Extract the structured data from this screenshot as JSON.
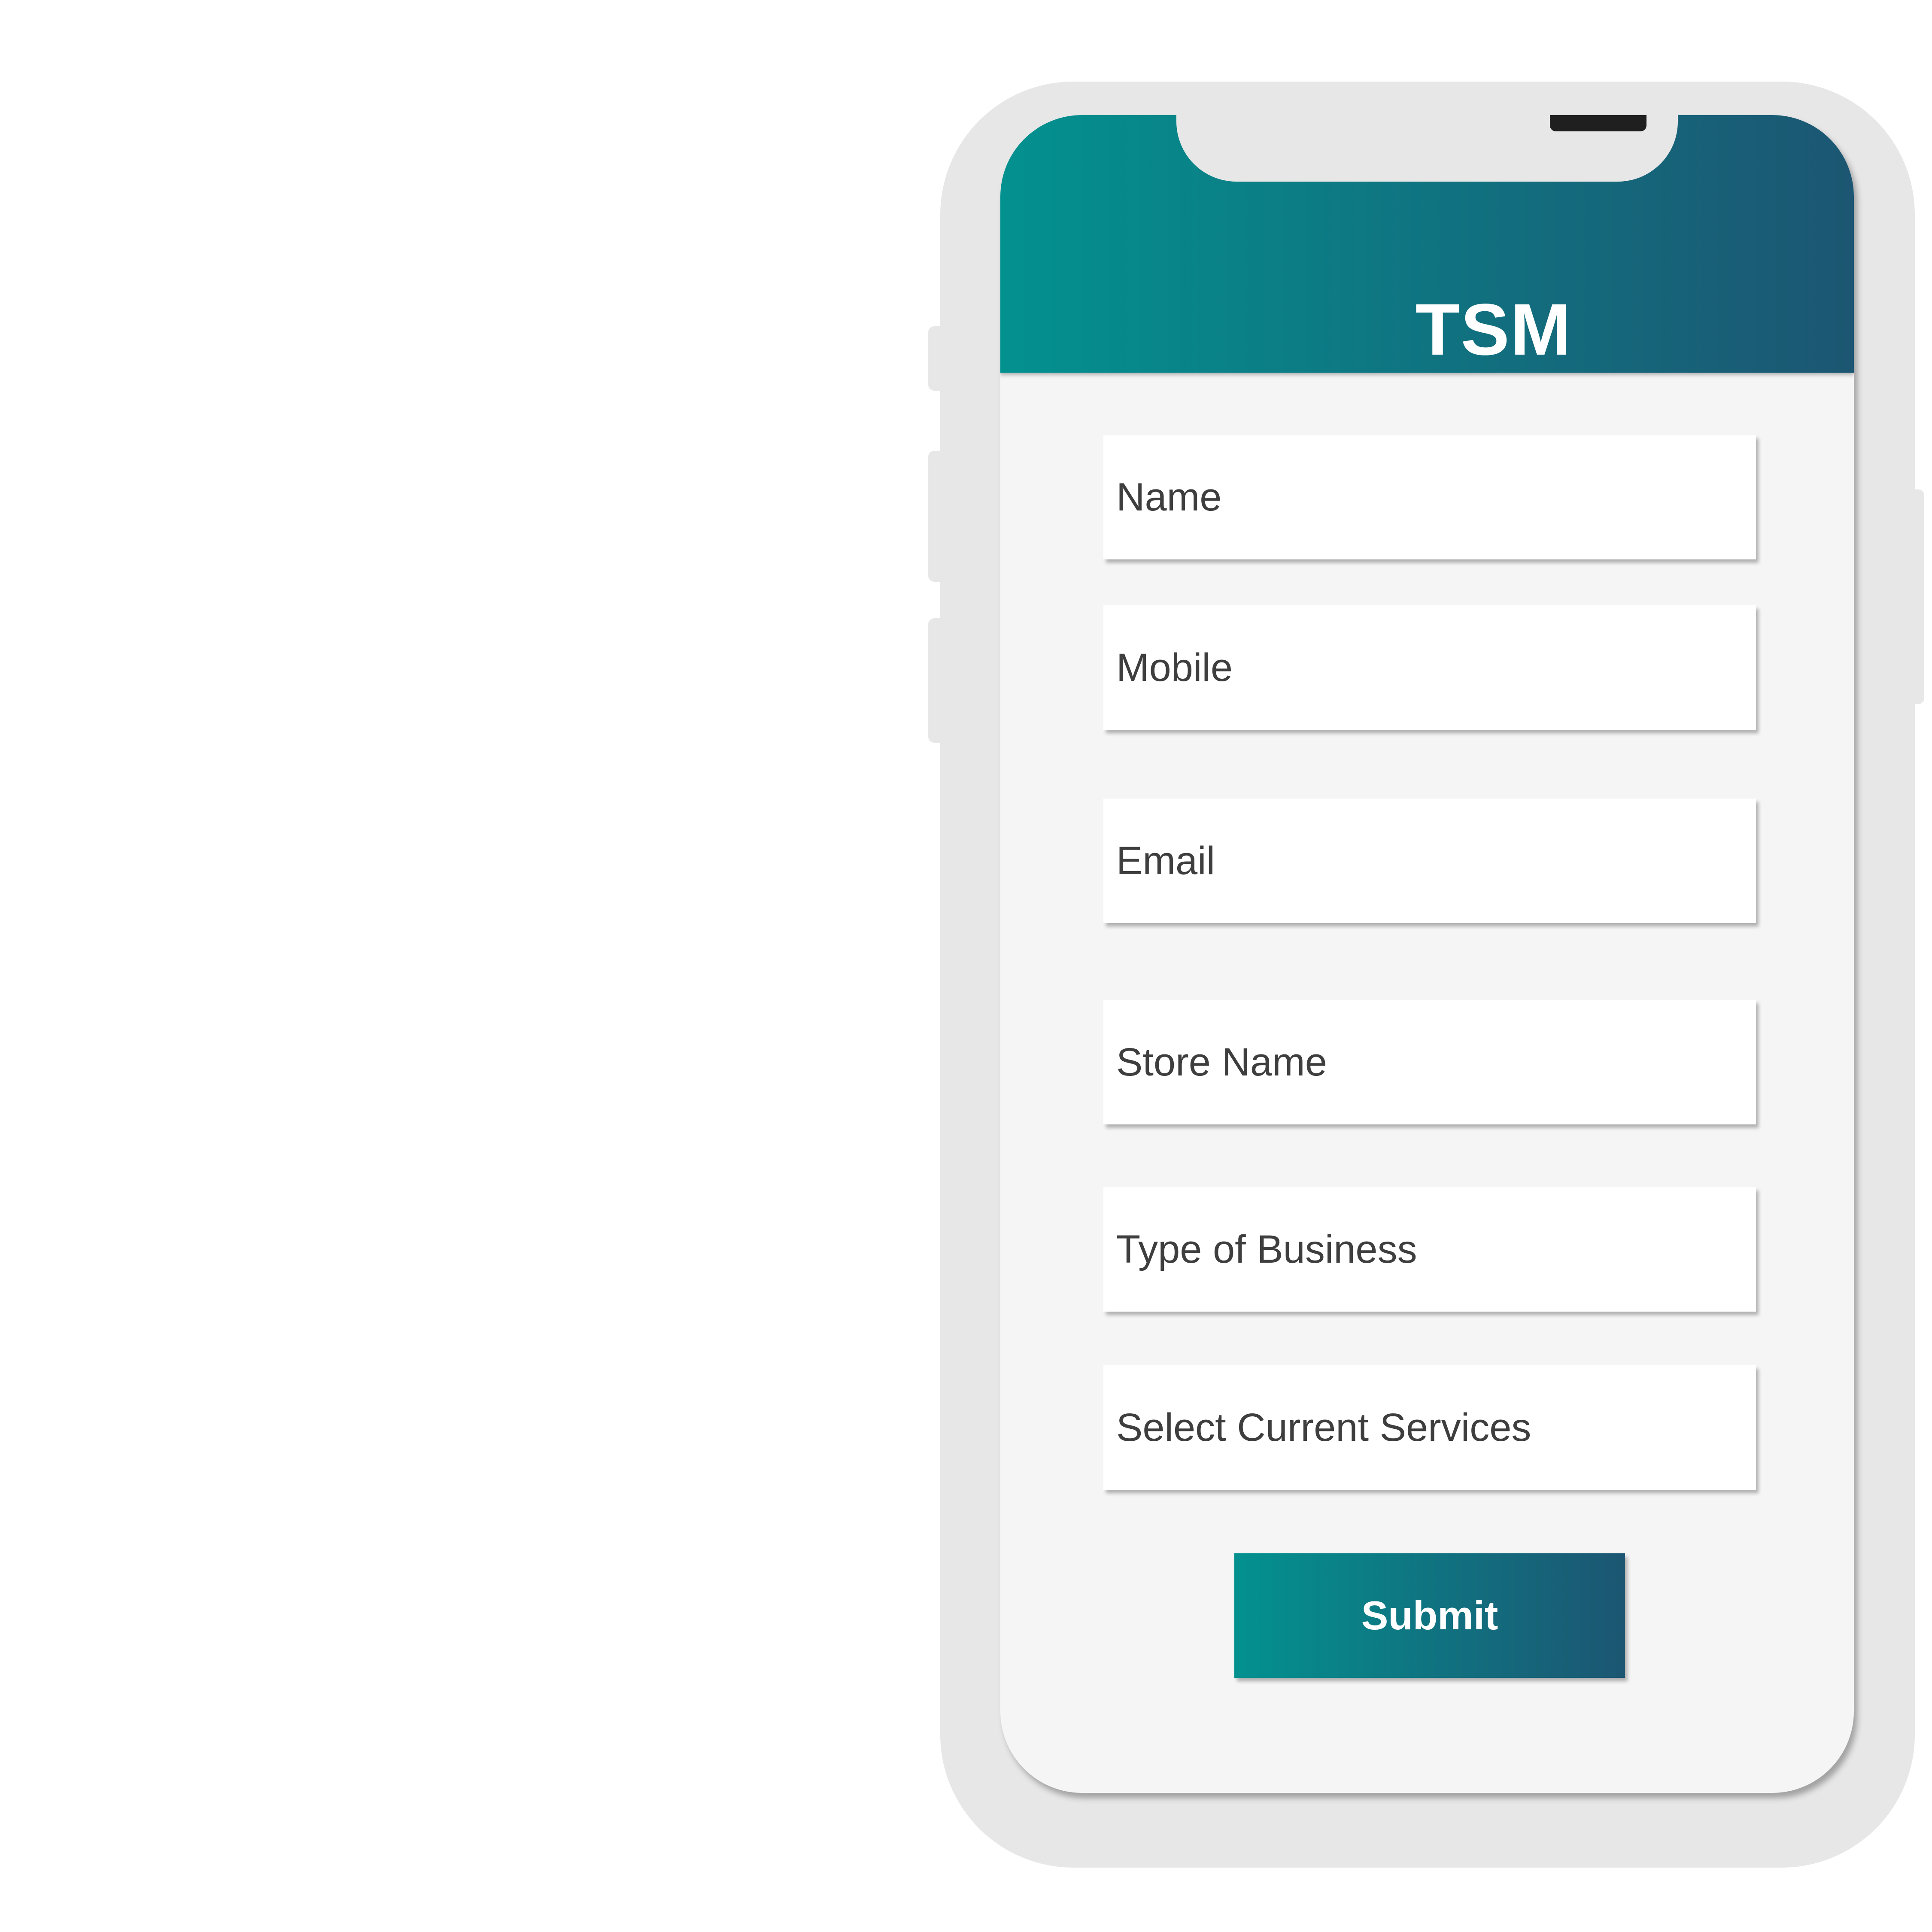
{
  "app": {
    "title": "TSM"
  },
  "form": {
    "fields": [
      {
        "placeholder": "Name"
      },
      {
        "placeholder": "Mobile"
      },
      {
        "placeholder": "Email"
      },
      {
        "placeholder": "Store Name"
      },
      {
        "placeholder": "Type of Business"
      },
      {
        "placeholder": "Select Current Services"
      }
    ],
    "submit_label": "Submit"
  },
  "colors": {
    "gradient_start": "#03918f",
    "gradient_end": "#1c5672",
    "device_frame": "#e7e7e7",
    "screen_background": "#f5f5f5"
  }
}
